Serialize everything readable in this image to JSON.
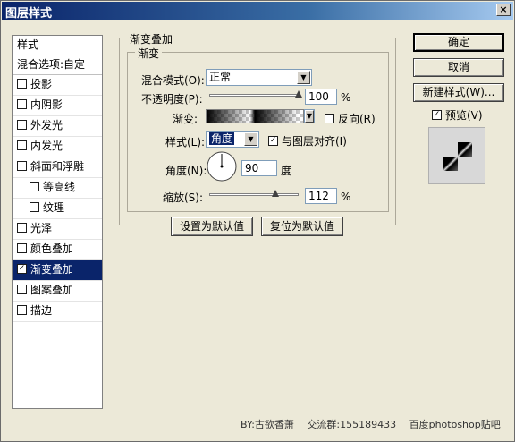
{
  "window": {
    "title": "图层样式",
    "close_label": "×"
  },
  "styles_panel": {
    "header": "样式",
    "blend_options": "混合选项:自定",
    "items": [
      {
        "label": "投影",
        "checked": false,
        "sub": false,
        "selected": false
      },
      {
        "label": "内阴影",
        "checked": false,
        "sub": false,
        "selected": false
      },
      {
        "label": "外发光",
        "checked": false,
        "sub": false,
        "selected": false
      },
      {
        "label": "内发光",
        "checked": false,
        "sub": false,
        "selected": false
      },
      {
        "label": "斜面和浮雕",
        "checked": false,
        "sub": false,
        "selected": false
      },
      {
        "label": "等高线",
        "checked": false,
        "sub": true,
        "selected": false
      },
      {
        "label": "纹理",
        "checked": false,
        "sub": true,
        "selected": false
      },
      {
        "label": "光泽",
        "checked": false,
        "sub": false,
        "selected": false
      },
      {
        "label": "颜色叠加",
        "checked": false,
        "sub": false,
        "selected": false
      },
      {
        "label": "渐变叠加",
        "checked": true,
        "sub": false,
        "selected": true
      },
      {
        "label": "图案叠加",
        "checked": false,
        "sub": false,
        "selected": false
      },
      {
        "label": "描边",
        "checked": false,
        "sub": false,
        "selected": false
      }
    ]
  },
  "gradient_overlay": {
    "group_title": "渐变叠加",
    "sub_group_title": "渐变",
    "blend_mode_label": "混合模式(O):",
    "blend_mode_value": "正常",
    "opacity_label": "不透明度(P):",
    "opacity_value": "100",
    "opacity_unit": "%",
    "opacity_fraction": 1.0,
    "gradient_label": "渐变:",
    "reverse_label": "反向(R)",
    "reverse_checked": false,
    "style_label": "样式(L):",
    "style_value": "角度",
    "align_label": "与图层对齐(I)",
    "align_checked": true,
    "angle_label": "角度(N):",
    "angle_value": "90",
    "angle_unit": "度",
    "scale_label": "缩放(S):",
    "scale_value": "112",
    "scale_unit": "%",
    "scale_fraction": 0.74,
    "set_default_label": "设置为默认值",
    "reset_default_label": "复位为默认值"
  },
  "buttons": {
    "ok": "确定",
    "cancel": "取消",
    "new_style": "新建样式(W)...",
    "preview_label": "预览(V)",
    "preview_checked": true
  },
  "footer": "BY:古欲香萧　 交流群:155189433　 百度photoshop贴吧"
}
